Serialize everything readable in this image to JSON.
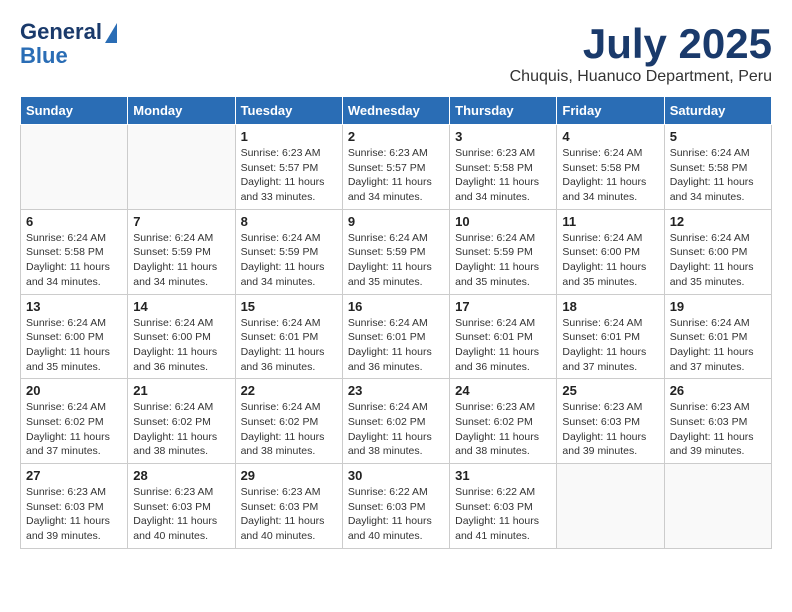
{
  "logo": {
    "line1": "General",
    "line2": "Blue"
  },
  "title": "July 2025",
  "subtitle": "Chuquis, Huanuco Department, Peru",
  "weekdays": [
    "Sunday",
    "Monday",
    "Tuesday",
    "Wednesday",
    "Thursday",
    "Friday",
    "Saturday"
  ],
  "weeks": [
    [
      {
        "day": "",
        "sunrise": "",
        "sunset": "",
        "daylight": ""
      },
      {
        "day": "",
        "sunrise": "",
        "sunset": "",
        "daylight": ""
      },
      {
        "day": "1",
        "sunrise": "Sunrise: 6:23 AM",
        "sunset": "Sunset: 5:57 PM",
        "daylight": "Daylight: 11 hours and 33 minutes."
      },
      {
        "day": "2",
        "sunrise": "Sunrise: 6:23 AM",
        "sunset": "Sunset: 5:57 PM",
        "daylight": "Daylight: 11 hours and 34 minutes."
      },
      {
        "day": "3",
        "sunrise": "Sunrise: 6:23 AM",
        "sunset": "Sunset: 5:58 PM",
        "daylight": "Daylight: 11 hours and 34 minutes."
      },
      {
        "day": "4",
        "sunrise": "Sunrise: 6:24 AM",
        "sunset": "Sunset: 5:58 PM",
        "daylight": "Daylight: 11 hours and 34 minutes."
      },
      {
        "day": "5",
        "sunrise": "Sunrise: 6:24 AM",
        "sunset": "Sunset: 5:58 PM",
        "daylight": "Daylight: 11 hours and 34 minutes."
      }
    ],
    [
      {
        "day": "6",
        "sunrise": "Sunrise: 6:24 AM",
        "sunset": "Sunset: 5:58 PM",
        "daylight": "Daylight: 11 hours and 34 minutes."
      },
      {
        "day": "7",
        "sunrise": "Sunrise: 6:24 AM",
        "sunset": "Sunset: 5:59 PM",
        "daylight": "Daylight: 11 hours and 34 minutes."
      },
      {
        "day": "8",
        "sunrise": "Sunrise: 6:24 AM",
        "sunset": "Sunset: 5:59 PM",
        "daylight": "Daylight: 11 hours and 34 minutes."
      },
      {
        "day": "9",
        "sunrise": "Sunrise: 6:24 AM",
        "sunset": "Sunset: 5:59 PM",
        "daylight": "Daylight: 11 hours and 35 minutes."
      },
      {
        "day": "10",
        "sunrise": "Sunrise: 6:24 AM",
        "sunset": "Sunset: 5:59 PM",
        "daylight": "Daylight: 11 hours and 35 minutes."
      },
      {
        "day": "11",
        "sunrise": "Sunrise: 6:24 AM",
        "sunset": "Sunset: 6:00 PM",
        "daylight": "Daylight: 11 hours and 35 minutes."
      },
      {
        "day": "12",
        "sunrise": "Sunrise: 6:24 AM",
        "sunset": "Sunset: 6:00 PM",
        "daylight": "Daylight: 11 hours and 35 minutes."
      }
    ],
    [
      {
        "day": "13",
        "sunrise": "Sunrise: 6:24 AM",
        "sunset": "Sunset: 6:00 PM",
        "daylight": "Daylight: 11 hours and 35 minutes."
      },
      {
        "day": "14",
        "sunrise": "Sunrise: 6:24 AM",
        "sunset": "Sunset: 6:00 PM",
        "daylight": "Daylight: 11 hours and 36 minutes."
      },
      {
        "day": "15",
        "sunrise": "Sunrise: 6:24 AM",
        "sunset": "Sunset: 6:01 PM",
        "daylight": "Daylight: 11 hours and 36 minutes."
      },
      {
        "day": "16",
        "sunrise": "Sunrise: 6:24 AM",
        "sunset": "Sunset: 6:01 PM",
        "daylight": "Daylight: 11 hours and 36 minutes."
      },
      {
        "day": "17",
        "sunrise": "Sunrise: 6:24 AM",
        "sunset": "Sunset: 6:01 PM",
        "daylight": "Daylight: 11 hours and 36 minutes."
      },
      {
        "day": "18",
        "sunrise": "Sunrise: 6:24 AM",
        "sunset": "Sunset: 6:01 PM",
        "daylight": "Daylight: 11 hours and 37 minutes."
      },
      {
        "day": "19",
        "sunrise": "Sunrise: 6:24 AM",
        "sunset": "Sunset: 6:01 PM",
        "daylight": "Daylight: 11 hours and 37 minutes."
      }
    ],
    [
      {
        "day": "20",
        "sunrise": "Sunrise: 6:24 AM",
        "sunset": "Sunset: 6:02 PM",
        "daylight": "Daylight: 11 hours and 37 minutes."
      },
      {
        "day": "21",
        "sunrise": "Sunrise: 6:24 AM",
        "sunset": "Sunset: 6:02 PM",
        "daylight": "Daylight: 11 hours and 38 minutes."
      },
      {
        "day": "22",
        "sunrise": "Sunrise: 6:24 AM",
        "sunset": "Sunset: 6:02 PM",
        "daylight": "Daylight: 11 hours and 38 minutes."
      },
      {
        "day": "23",
        "sunrise": "Sunrise: 6:24 AM",
        "sunset": "Sunset: 6:02 PM",
        "daylight": "Daylight: 11 hours and 38 minutes."
      },
      {
        "day": "24",
        "sunrise": "Sunrise: 6:23 AM",
        "sunset": "Sunset: 6:02 PM",
        "daylight": "Daylight: 11 hours and 38 minutes."
      },
      {
        "day": "25",
        "sunrise": "Sunrise: 6:23 AM",
        "sunset": "Sunset: 6:03 PM",
        "daylight": "Daylight: 11 hours and 39 minutes."
      },
      {
        "day": "26",
        "sunrise": "Sunrise: 6:23 AM",
        "sunset": "Sunset: 6:03 PM",
        "daylight": "Daylight: 11 hours and 39 minutes."
      }
    ],
    [
      {
        "day": "27",
        "sunrise": "Sunrise: 6:23 AM",
        "sunset": "Sunset: 6:03 PM",
        "daylight": "Daylight: 11 hours and 39 minutes."
      },
      {
        "day": "28",
        "sunrise": "Sunrise: 6:23 AM",
        "sunset": "Sunset: 6:03 PM",
        "daylight": "Daylight: 11 hours and 40 minutes."
      },
      {
        "day": "29",
        "sunrise": "Sunrise: 6:23 AM",
        "sunset": "Sunset: 6:03 PM",
        "daylight": "Daylight: 11 hours and 40 minutes."
      },
      {
        "day": "30",
        "sunrise": "Sunrise: 6:22 AM",
        "sunset": "Sunset: 6:03 PM",
        "daylight": "Daylight: 11 hours and 40 minutes."
      },
      {
        "day": "31",
        "sunrise": "Sunrise: 6:22 AM",
        "sunset": "Sunset: 6:03 PM",
        "daylight": "Daylight: 11 hours and 41 minutes."
      },
      {
        "day": "",
        "sunrise": "",
        "sunset": "",
        "daylight": ""
      },
      {
        "day": "",
        "sunrise": "",
        "sunset": "",
        "daylight": ""
      }
    ]
  ]
}
